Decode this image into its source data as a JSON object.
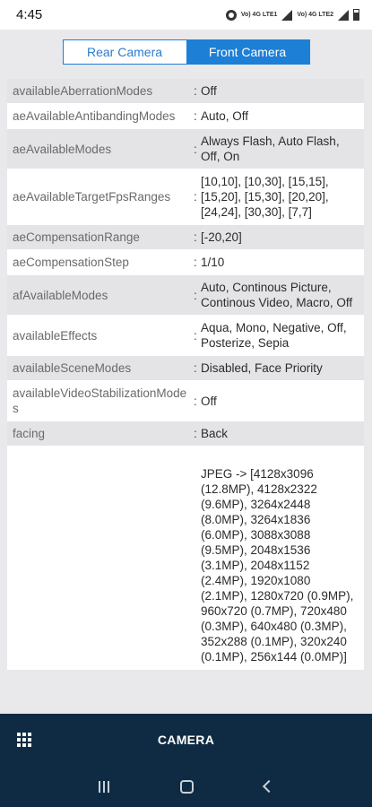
{
  "status": {
    "time": "4:45",
    "volte1": "Vo) 4G LTE1",
    "volte2": "Vo) 4G LTE2"
  },
  "tabs": [
    {
      "label": "Rear Camera",
      "selected": false
    },
    {
      "label": "Front Camera",
      "selected": true
    }
  ],
  "rows": [
    {
      "key": "availableAberrationModes",
      "value": "Off"
    },
    {
      "key": "aeAvailableAntibandingModes",
      "value": "Auto, Off"
    },
    {
      "key": "aeAvailableModes",
      "value": "Always Flash, Auto Flash, Off, On"
    },
    {
      "key": "aeAvailableTargetFpsRanges",
      "value": "[10,10], [10,30], [15,15], [15,20], [15,30], [20,20], [24,24], [30,30], [7,7]"
    },
    {
      "key": "aeCompensationRange",
      "value": "[-20,20]"
    },
    {
      "key": "aeCompensationStep",
      "value": "1/10"
    },
    {
      "key": "afAvailableModes",
      "value": "Auto, Continous Picture, Continous Video, Macro, Off"
    },
    {
      "key": "availableEffects",
      "value": "Aqua, Mono, Negative, Off, Posterize, Sepia"
    },
    {
      "key": "availableSceneModes",
      "value": "Disabled, Face Priority"
    },
    {
      "key": "availableVideoStabilizationModes",
      "value": "Off"
    },
    {
      "key": "facing",
      "value": "Back"
    },
    {
      "key": "",
      "value": "JPEG -> [4128x3096 (12.8MP), 4128x2322 (9.6MP), 3264x2448 (8.0MP), 3264x1836 (6.0MP), 3088x3088 (9.5MP), 2048x1536 (3.1MP), 2048x1152 (2.4MP), 1920x1080 (2.1MP), 1280x720 (0.9MP), 960x720 (0.7MP), 720x480 (0.3MP), 640x480 (0.3MP), 352x288 (0.1MP), 320x240 (0.1MP), 256x144 (0.0MP)]"
    }
  ],
  "separator": ":",
  "bottom": {
    "title": "CAMERA",
    "menu_icon": "grid-menu-icon"
  },
  "nav": {
    "recent_icon": "recent-apps-icon",
    "home_icon": "home-icon",
    "back_icon": "back-icon"
  }
}
